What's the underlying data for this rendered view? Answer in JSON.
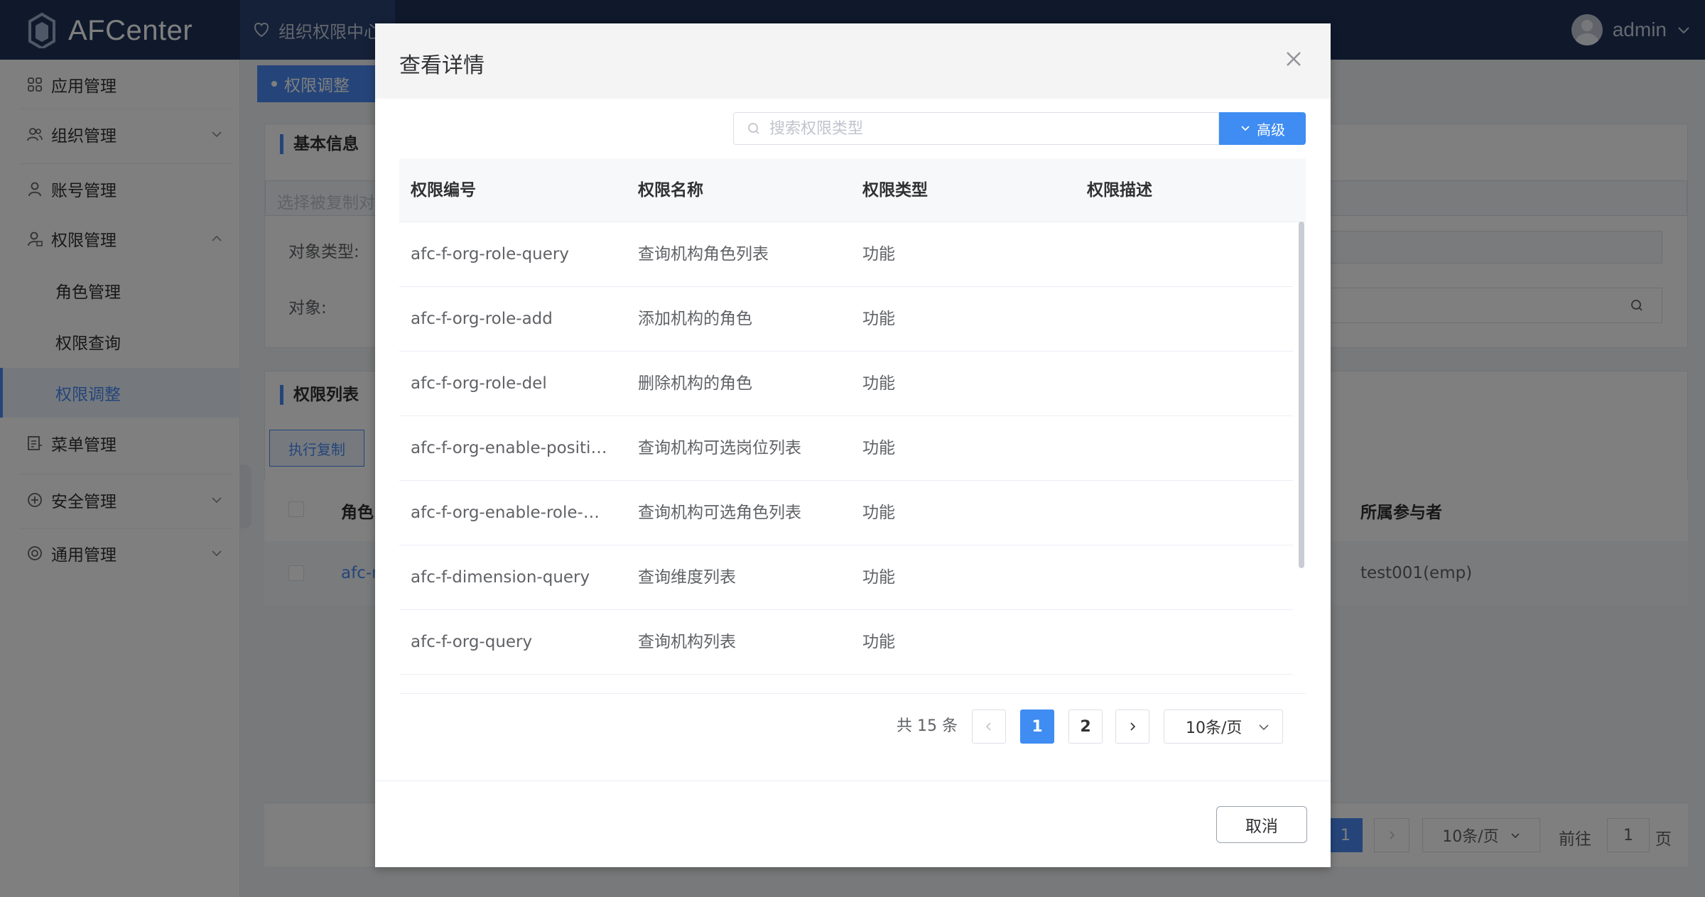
{
  "header": {
    "logo_text": "AFCenter",
    "app_tab": "组织权限中心",
    "user_name": "admin"
  },
  "sidebar": {
    "items": [
      {
        "label": "应用管理",
        "icon": "grid-icon"
      },
      {
        "label": "组织管理",
        "icon": "users-icon"
      },
      {
        "label": "账号管理",
        "icon": "user-icon"
      },
      {
        "label": "权限管理",
        "icon": "user-lock-icon"
      },
      {
        "label": "角色管理"
      },
      {
        "label": "权限查询"
      },
      {
        "label": "权限调整"
      },
      {
        "label": "菜单管理",
        "icon": "menu-icon"
      },
      {
        "label": "安全管理",
        "icon": "shield-plus-icon"
      },
      {
        "label": "通用管理",
        "icon": "settings-icon"
      }
    ]
  },
  "main": {
    "page_tab": "权限调整",
    "basic_info_title": "基本信息",
    "copy_select_placeholder": "选择被复制对",
    "object_type_label": "对象类型:",
    "object_label": "对象:",
    "perm_list_title": "权限列表",
    "execute_copy_btn": "执行复制",
    "col_role": "角色",
    "col_participant": "所属参与者",
    "row_role": "afc-r",
    "row_participant": "test001(emp)",
    "pager_page": "1",
    "pager_size": "10条/页",
    "goto_label": "前往",
    "goto_value": "1",
    "page_suffix": "页"
  },
  "dialog": {
    "title": "查看详情",
    "search_placeholder": "搜索权限类型",
    "advanced_btn": "高级",
    "columns": [
      "权限编号",
      "权限名称",
      "权限类型",
      "权限描述"
    ],
    "rows": [
      {
        "code": "afc-f-org-role-query",
        "name": "查询机构角色列表",
        "type": "功能",
        "desc": ""
      },
      {
        "code": "afc-f-org-role-add",
        "name": "添加机构的角色",
        "type": "功能",
        "desc": ""
      },
      {
        "code": "afc-f-org-role-del",
        "name": "删除机构的角色",
        "type": "功能",
        "desc": ""
      },
      {
        "code": "afc-f-org-enable-positi…",
        "name": "查询机构可选岗位列表",
        "type": "功能",
        "desc": ""
      },
      {
        "code": "afc-f-org-enable-role-…",
        "name": "查询机构可选角色列表",
        "type": "功能",
        "desc": ""
      },
      {
        "code": "afc-f-dimension-query",
        "name": "查询维度列表",
        "type": "功能",
        "desc": ""
      },
      {
        "code": "afc-f-org-query",
        "name": "查询机构列表",
        "type": "功能",
        "desc": ""
      },
      {
        "code": "",
        "name": "",
        "type": "",
        "desc": ""
      }
    ],
    "total_text": "共 15 条",
    "pages": [
      "1",
      "2"
    ],
    "current_page": "1",
    "page_size": "10条/页",
    "cancel_btn": "取消"
  },
  "colors": {
    "header_bg": "#1f3257",
    "primary": "#3f8cf2",
    "sidebar_active_bg": "#ebf2fd"
  }
}
